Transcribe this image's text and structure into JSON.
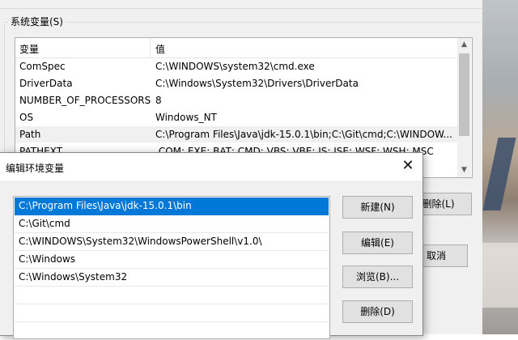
{
  "system_variables": {
    "group_label": "系统变量(S)",
    "col_name": "变量",
    "col_value": "值",
    "rows": [
      {
        "name": "ComSpec",
        "value": "C:\\WINDOWS\\system32\\cmd.exe"
      },
      {
        "name": "DriverData",
        "value": "C:\\Windows\\System32\\Drivers\\DriverData"
      },
      {
        "name": "NUMBER_OF_PROCESSORS",
        "value": "8"
      },
      {
        "name": "OS",
        "value": "Windows_NT"
      },
      {
        "name": "Path",
        "value": "C:\\Program Files\\Java\\jdk-15.0.1\\bin;C:\\Git\\cmd;C:\\WINDOW..."
      },
      {
        "name": "PATHEXT",
        "value": ".COM;.EXE;.BAT;.CMD;.VBS;.VBE;.JS;.JSE;.WSF;.WSH;.MSC"
      }
    ],
    "delete_label": "删除(L)",
    "cancel_label": "取消"
  },
  "edit_dialog": {
    "title": "编辑环境变量",
    "close_glyph": "✕",
    "paths": [
      "C:\\Program Files\\Java\\jdk-15.0.1\\bin",
      "C:\\Git\\cmd",
      "C:\\WINDOWS\\System32\\WindowsPowerShell\\v1.0\\",
      "C:\\Windows",
      "C:\\Windows\\System32",
      "",
      "",
      ""
    ],
    "buttons": {
      "new": "新建(N)",
      "edit": "编辑(E)",
      "browse": "浏览(B)...",
      "delete": "删除(D)"
    }
  },
  "colors": {
    "selection": "#0078d7",
    "dialog_bg": "#f0f0f0"
  }
}
